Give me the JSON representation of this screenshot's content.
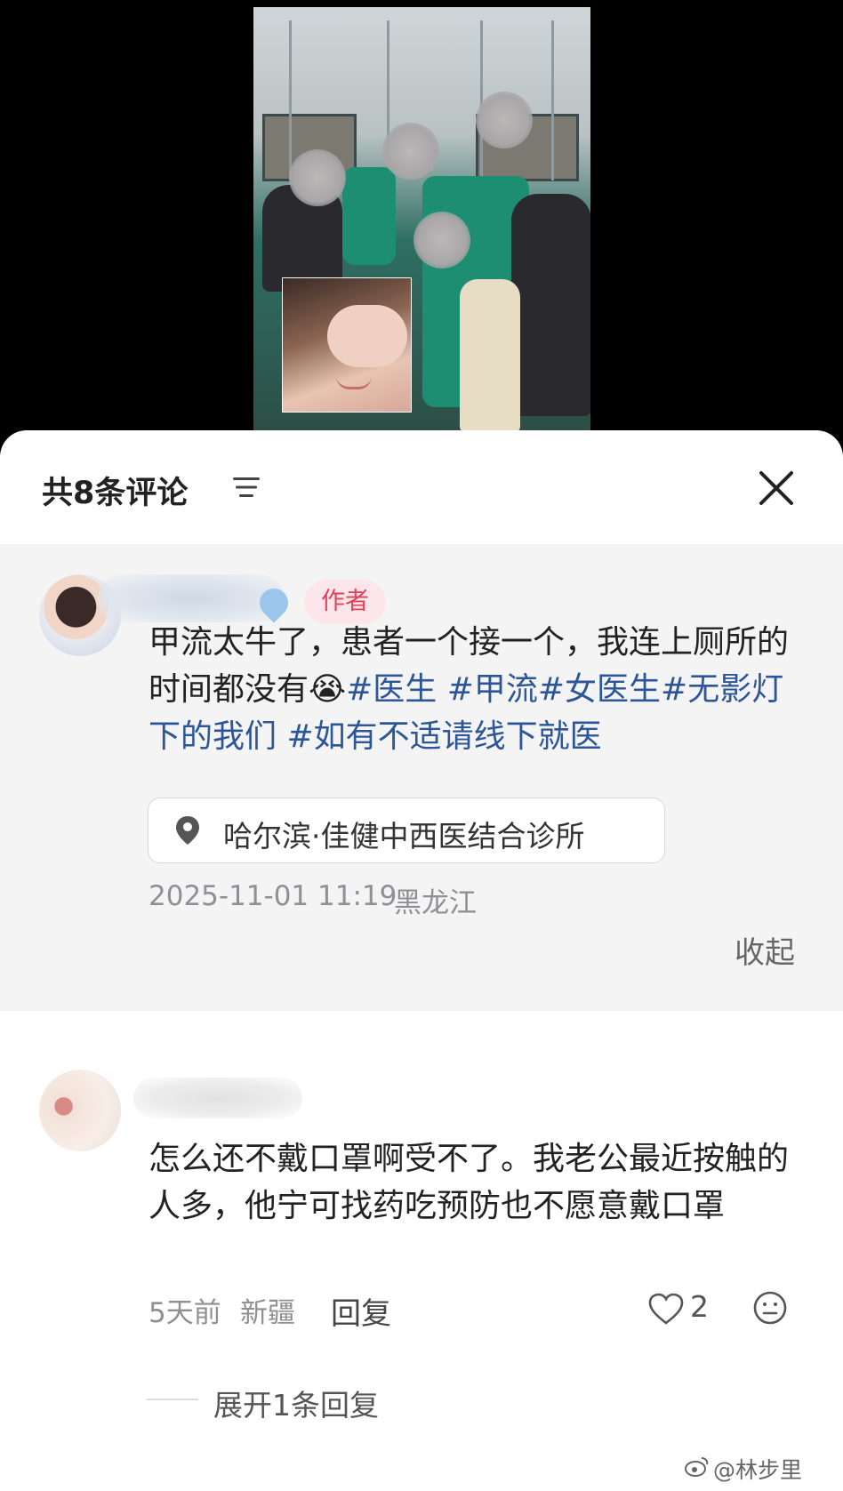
{
  "header": {
    "comment_count": "共8条评论"
  },
  "pinned_comment": {
    "badge": "作者",
    "text_plain": "甲流太牛了，患者一个接一个，我连上厕所的时间都没有",
    "emoji": "😭",
    "hashtags": [
      "#医生 ",
      "#甲流",
      "#女医生#",
      "无影灯下的我们 ",
      "#如有不适请线下就医"
    ],
    "location": "哈尔滨·佳健中西医结合诊所",
    "timestamp": "2025-11-01 11:19",
    "region": "黑龙江",
    "collapse_label": "收起"
  },
  "comment2": {
    "text": "怎么还不戴口罩啊受不了。我老公最近按触的人多，他宁可找药吃预防也不愿意戴口罩",
    "time": "5天前",
    "region": "新疆",
    "reply_label": "回复",
    "like_count": "2",
    "expand_label": "展开1条回复"
  },
  "watermark": {
    "text": "@林步里"
  },
  "icons": {
    "sort": "sort-icon",
    "close": "close-icon",
    "pin": "location-pin-icon",
    "like": "heart-icon",
    "emoji": "emoji-face-icon",
    "weibo": "weibo-logo-icon"
  },
  "colors": {
    "hashtag": "#2c5697",
    "badge_bg": "#fde6ea",
    "badge_text": "#e2405a",
    "pinned_bg": "#f4f4f5"
  }
}
